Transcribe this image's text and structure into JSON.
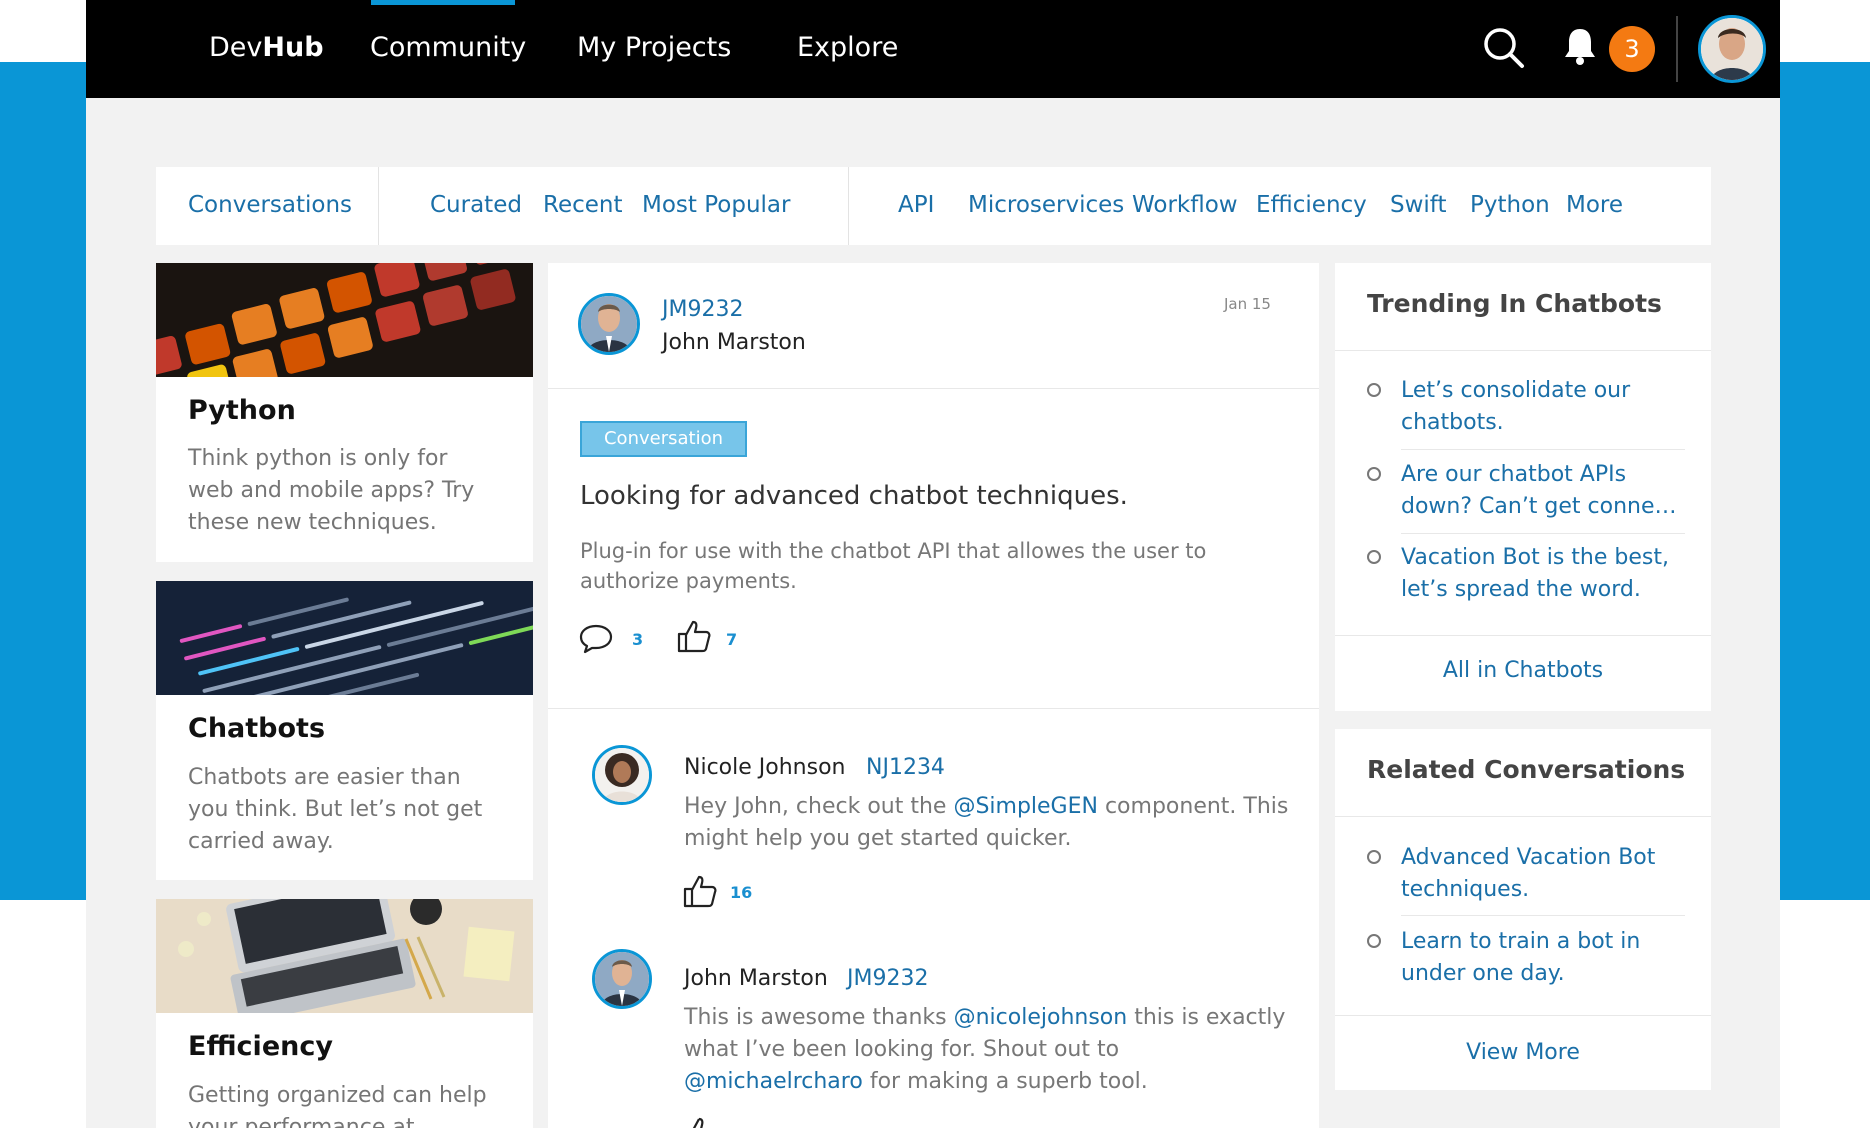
{
  "nav": {
    "brand_regular": "Dev",
    "brand_bold": "Hub",
    "items": [
      {
        "label": "Community"
      },
      {
        "label": "My Projects"
      },
      {
        "label": "Explore"
      }
    ],
    "notification_count": "3",
    "accent": "#0a96d6",
    "badge_color": "#f47a12"
  },
  "filters": {
    "conversations": "Conversations",
    "curated": "Curated",
    "recent": "Recent",
    "popular": "Most Popular",
    "tags": [
      "API",
      "Microservices",
      "Workflow",
      "Efficiency",
      "Swift",
      "Python",
      "More"
    ]
  },
  "topics": [
    {
      "title": "Python",
      "desc": "Think python is only for web and mobile apps? Try these new techniques."
    },
    {
      "title": "Chatbots",
      "desc": "Chatbots are easier than you think. But let’s not get carried away."
    },
    {
      "title": "Efficiency",
      "desc": "Getting organized can help your performance at"
    }
  ],
  "post": {
    "handle": "JM9232",
    "author": "John Marston",
    "date": "Jan 15",
    "tag": "Conversation",
    "title": "Looking for advanced chatbot techniques.",
    "body": "Plug-in for use with the chatbot API that allowes the user to authorize payments.",
    "comments": "3",
    "likes": "7"
  },
  "replies": [
    {
      "author": "Nicole Johnson",
      "handle": "NJ1234",
      "pre": "Hey John, check out the ",
      "mention1": "@SimpleGEN",
      "mid": " component. This might help you get started quicker.",
      "likes": "16"
    },
    {
      "author": "John Marston",
      "handle": "JM9232",
      "pre": "This is awesome thanks ",
      "mention1": "@nicolejohnson",
      "mid": " this is exactly what I’ve been looking for. Shout out to ",
      "mention2": "@michaelrcharo",
      "post": " for making a superb tool."
    }
  ],
  "trending": {
    "title": "Trending In Chatbots",
    "items": [
      "Let’s consolidate our chatbots.",
      "Are our chatbot APIs down? Can’t get conne…",
      "Vacation Bot is the best, let’s spread the word."
    ],
    "footer": "All in Chatbots"
  },
  "related": {
    "title": "Related Conversations",
    "items": [
      "Advanced Vacation Bot techniques.",
      "Learn to train a bot in under one day."
    ],
    "footer": "View More"
  }
}
